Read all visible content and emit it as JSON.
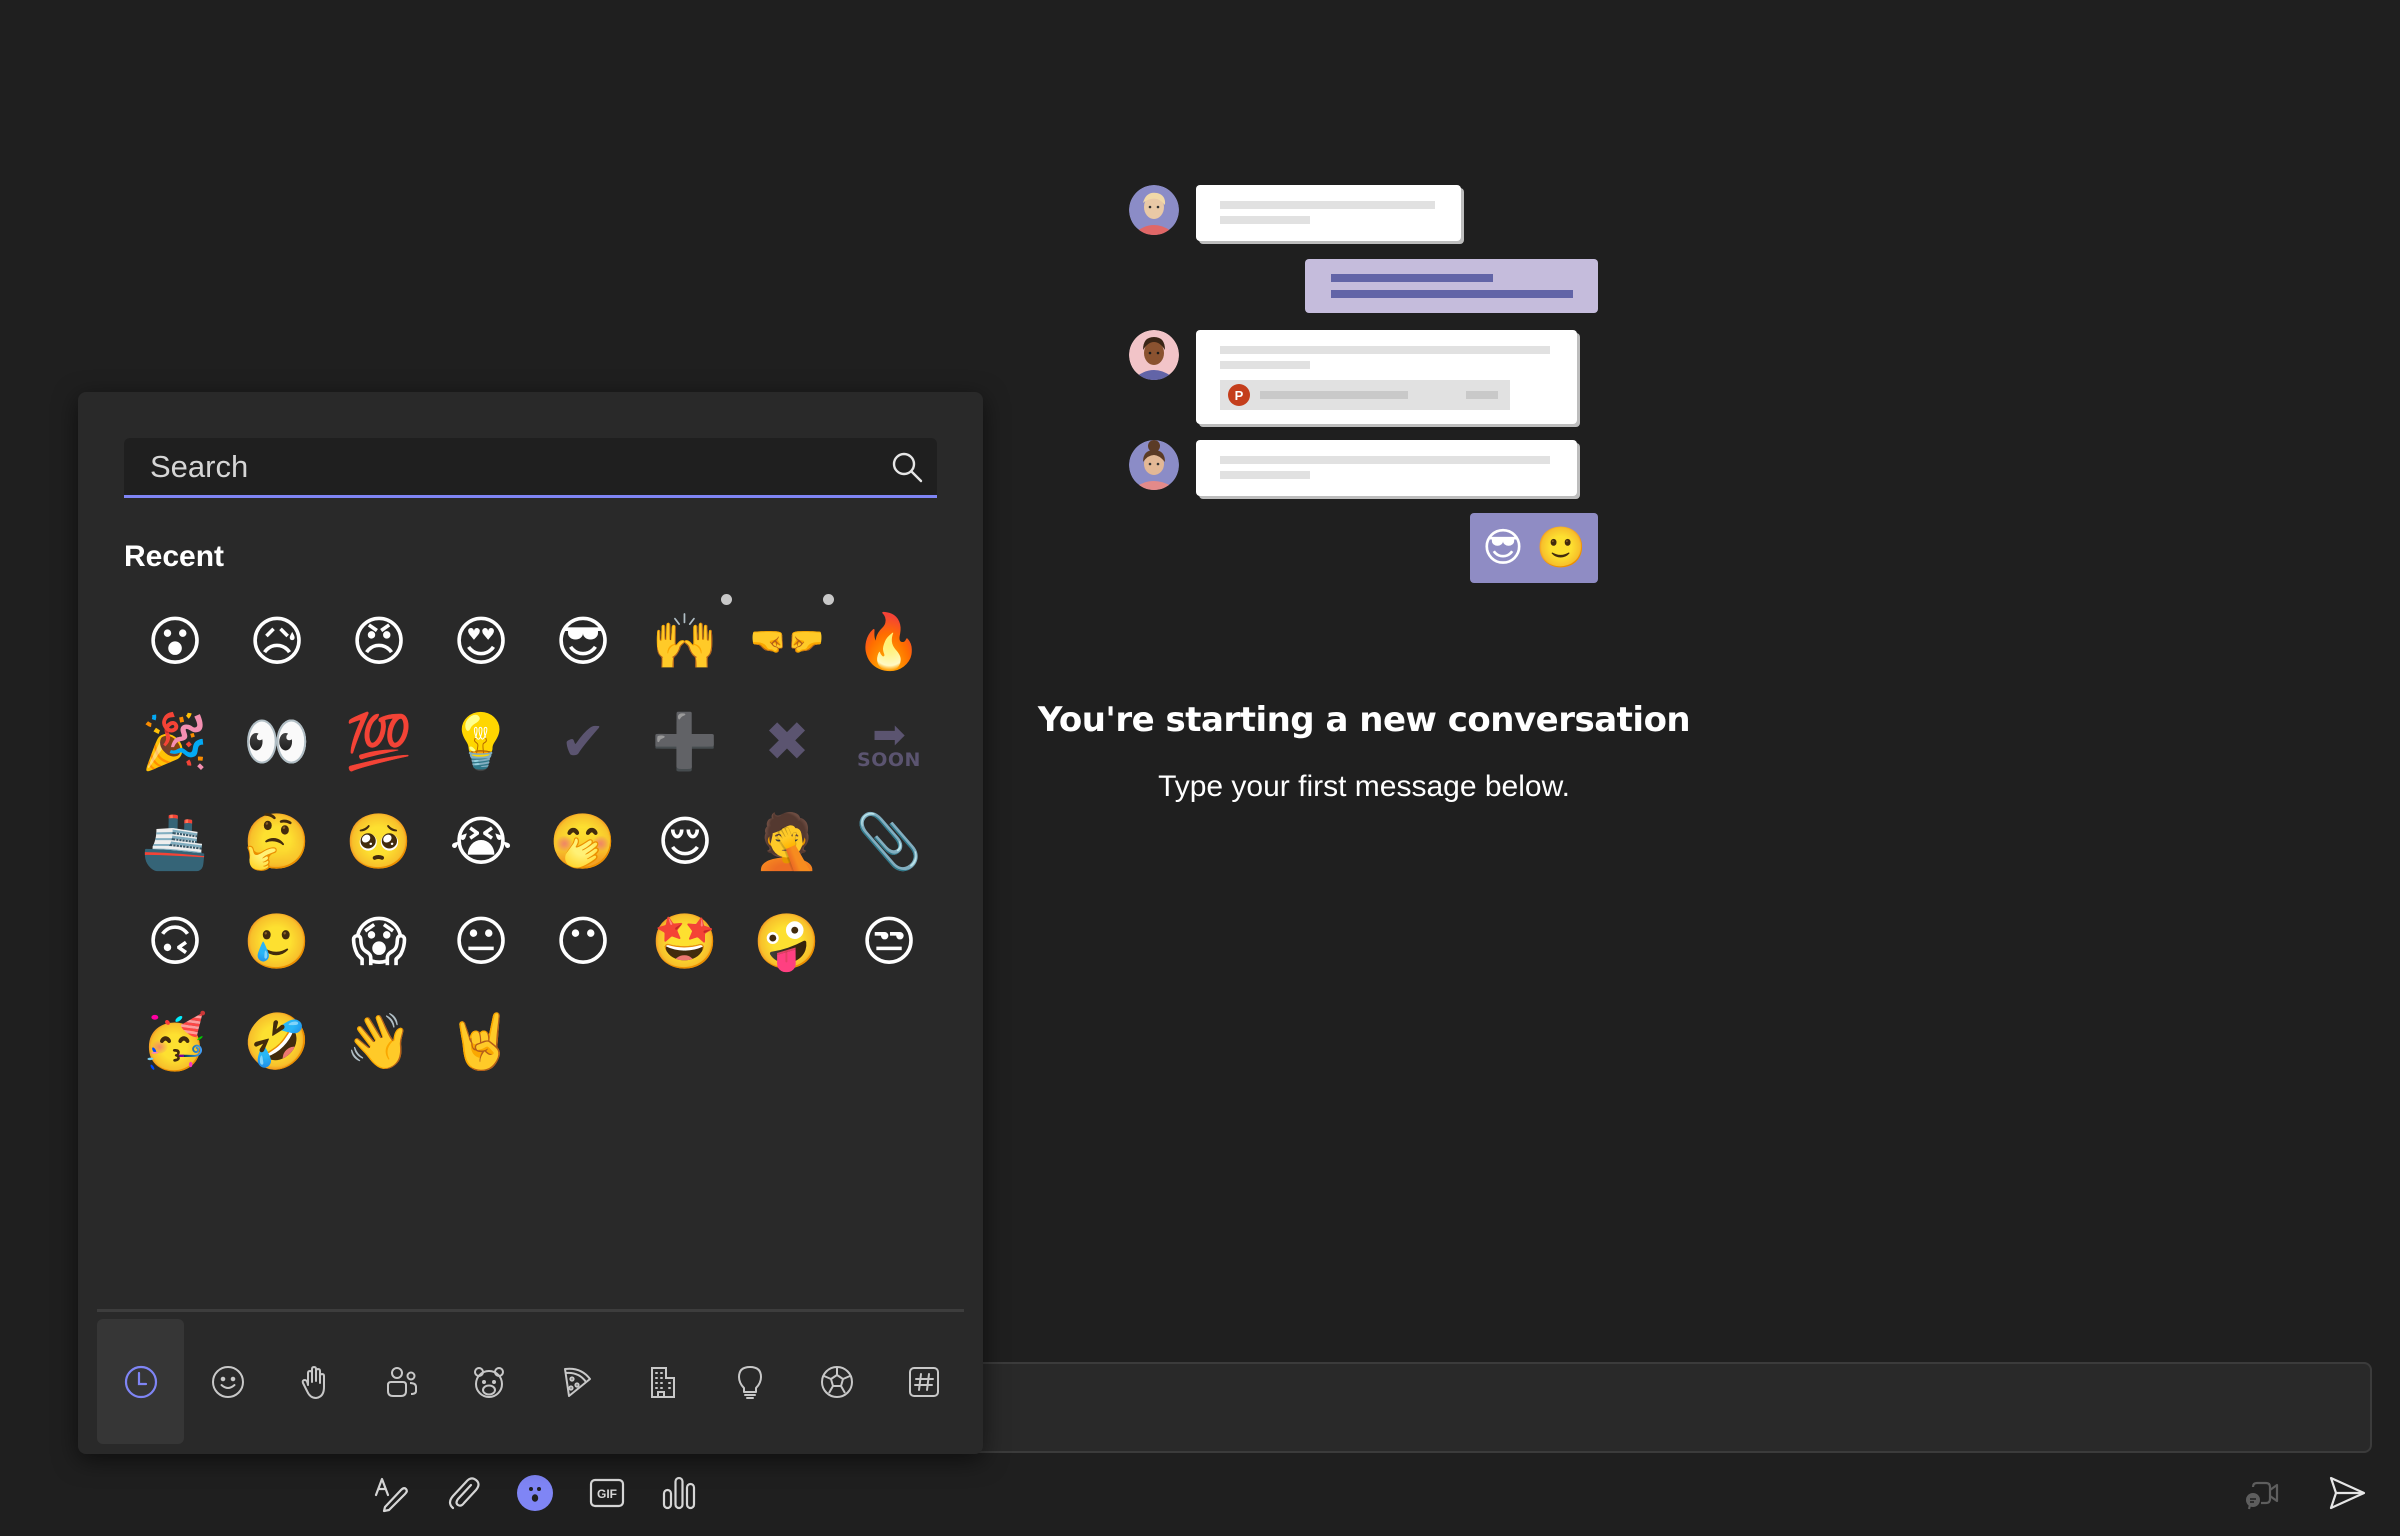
{
  "empty_state": {
    "title": "You're starting a new conversation",
    "subtitle": "Type your first message below.",
    "illustration": {
      "own_emoji_message": [
        "😎",
        "🙂"
      ],
      "attachment_icon": "powerpoint-icon",
      "attachment_icon_letter": "P"
    }
  },
  "emoji_picker": {
    "search": {
      "placeholder": "Search",
      "value": "",
      "icon": "search-icon"
    },
    "section_title": "Recent",
    "recent": [
      {
        "name": "hushed-face",
        "char": "😮"
      },
      {
        "name": "sad-but-relieved-face",
        "char": "😥"
      },
      {
        "name": "angry-face",
        "char": "😠"
      },
      {
        "name": "heart-eyes-face",
        "char": "😍"
      },
      {
        "name": "sunglasses-face",
        "char": "😎"
      },
      {
        "name": "raising-hands",
        "char": "🙌",
        "has_variants": true
      },
      {
        "name": "fist-bump",
        "char": "🤜🤛",
        "has_variants": true
      },
      {
        "name": "fire",
        "char": "🔥"
      },
      {
        "name": "party-popper",
        "char": "🎉"
      },
      {
        "name": "eyes",
        "char": "👀"
      },
      {
        "name": "hundred-points",
        "char": "💯"
      },
      {
        "name": "light-bulb",
        "char": "💡"
      },
      {
        "name": "check-mark",
        "char": "✔",
        "style": "muted"
      },
      {
        "name": "plus",
        "char": "➕",
        "style": "muted"
      },
      {
        "name": "cross-mark",
        "char": "✖",
        "style": "muted"
      },
      {
        "name": "soon-arrow",
        "char": "➡",
        "label": "SOON",
        "style": "soon"
      },
      {
        "name": "ship",
        "char": "🚢"
      },
      {
        "name": "thinking-face",
        "char": "🤔"
      },
      {
        "name": "pleading-face",
        "char": "🥺"
      },
      {
        "name": "loudly-crying-face",
        "char": "😭"
      },
      {
        "name": "face-with-hand-over-mouth",
        "char": "🤭"
      },
      {
        "name": "relieved-face",
        "char": "😌"
      },
      {
        "name": "facepalm-face",
        "char": "🤦"
      },
      {
        "name": "clippy",
        "char": "📎"
      },
      {
        "name": "upside-down-face",
        "char": "🙃"
      },
      {
        "name": "smiling-face-with-tear",
        "char": "🥲"
      },
      {
        "name": "face-screaming-in-fear",
        "char": "😱"
      },
      {
        "name": "neutral-face",
        "char": "😐"
      },
      {
        "name": "face-without-mouth",
        "char": "😶"
      },
      {
        "name": "star-struck",
        "char": "🤩"
      },
      {
        "name": "zany-face",
        "char": "🤪"
      },
      {
        "name": "unamused-face",
        "char": "😒"
      },
      {
        "name": "partying-face",
        "char": "🥳"
      },
      {
        "name": "rolling-on-floor-laughing",
        "char": "🤣"
      },
      {
        "name": "waving-face",
        "char": "👋"
      },
      {
        "name": "rock-on-face",
        "char": "🤘"
      }
    ],
    "categories": [
      {
        "name": "recent",
        "label": "Recent",
        "icon": "clock-icon",
        "selected": true
      },
      {
        "name": "smileys",
        "label": "Smileys",
        "icon": "smiley-icon"
      },
      {
        "name": "hand-gestures",
        "label": "Hand gestures",
        "icon": "hand-icon"
      },
      {
        "name": "people",
        "label": "People",
        "icon": "people-icon"
      },
      {
        "name": "animals",
        "label": "Animals",
        "icon": "bear-icon"
      },
      {
        "name": "food",
        "label": "Food",
        "icon": "pizza-icon"
      },
      {
        "name": "travel-places",
        "label": "Travel and places",
        "icon": "building-icon"
      },
      {
        "name": "activities-objects",
        "label": "Activities and objects",
        "icon": "lightbulb-icon"
      },
      {
        "name": "sports",
        "label": "Sports",
        "icon": "soccer-ball-icon"
      },
      {
        "name": "symbols",
        "label": "Symbols",
        "icon": "hashtag-icon"
      }
    ]
  },
  "composer": {
    "value": "",
    "toolbar": [
      {
        "name": "format",
        "icon": "format-pen-icon"
      },
      {
        "name": "attach",
        "icon": "paperclip-icon"
      },
      {
        "name": "emoji",
        "icon": "emoji-icon",
        "active": true
      },
      {
        "name": "gif",
        "icon": "gif-icon",
        "label": "GIF"
      },
      {
        "name": "loop-components",
        "icon": "loop-icon"
      }
    ],
    "right_actions": [
      {
        "name": "meet-now",
        "icon": "video-chat-icon",
        "disabled": true
      },
      {
        "name": "send",
        "icon": "send-icon"
      }
    ]
  },
  "colors": {
    "accent": "#7f85f5",
    "background": "#1f1f1f",
    "panel": "#292929",
    "own_bubble": "#c5bcdc",
    "own_bar": "#6264a7"
  }
}
